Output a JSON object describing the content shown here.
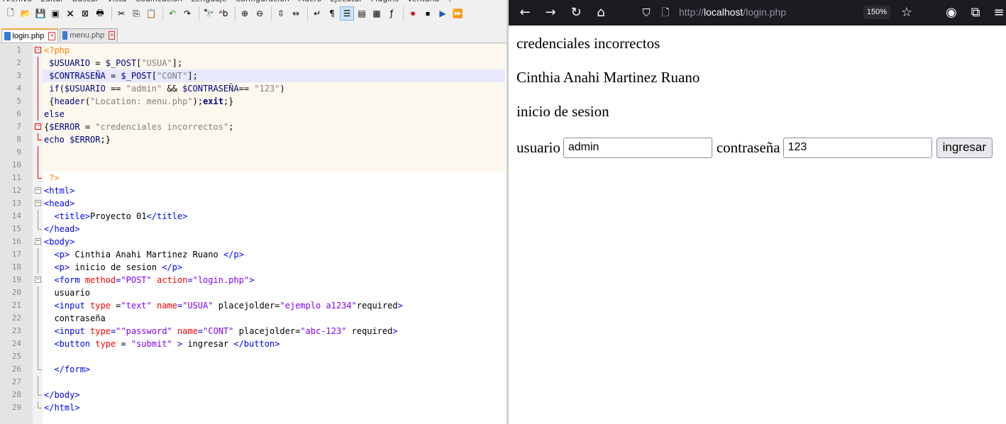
{
  "editor": {
    "menu": [
      "Archivo",
      "Editar",
      "Buscar",
      "Vista",
      "Codificación",
      "Lenguaje",
      "Configuración",
      "Macro",
      "Ejecutar",
      "Plugins",
      "Ventana",
      "?"
    ],
    "tabs": [
      {
        "label": "login.php",
        "active": true
      },
      {
        "label": "menu.php",
        "active": false
      }
    ],
    "lines": [
      {
        "n": "1",
        "seg": [
          [
            "php",
            "<?php"
          ]
        ]
      },
      {
        "n": "2",
        "seg": [
          [
            "var",
            "$USUARIO"
          ],
          [
            "",
            " = "
          ],
          [
            "var",
            "$_POST"
          ],
          [
            "",
            "["
          ],
          [
            "pstr",
            "\"USUA\""
          ],
          [
            "",
            "];"
          ]
        ]
      },
      {
        "n": "3",
        "seg": [
          [
            "var",
            "$CONTRASEÑA"
          ],
          [
            "",
            " = "
          ],
          [
            "var",
            "$_POST"
          ],
          [
            "",
            "["
          ],
          [
            "pstr",
            "\"CONT\""
          ],
          [
            "",
            "];"
          ]
        ]
      },
      {
        "n": "4",
        "seg": [
          [
            "fn",
            "if"
          ],
          [
            "",
            "("
          ],
          [
            "var",
            "$USUARIO"
          ],
          [
            "",
            " == "
          ],
          [
            "pstr",
            "\"admin\""
          ],
          [
            "",
            " && "
          ],
          [
            "var",
            "$CONTRASEÑA"
          ],
          [
            "",
            "== "
          ],
          [
            "pstr",
            "\"123\""
          ],
          [
            "",
            ")"
          ]
        ]
      },
      {
        "n": "5",
        "seg": [
          [
            "",
            "{"
          ],
          [
            "fn",
            "header"
          ],
          [
            "",
            "("
          ],
          [
            "pstr",
            "\"Location: menu.php\""
          ],
          [
            "",
            ");"
          ],
          [
            "kw",
            "exit"
          ],
          [
            "",
            ";}"
          ]
        ]
      },
      {
        "n": "6",
        "seg": [
          [
            "fn",
            "else"
          ]
        ]
      },
      {
        "n": "7",
        "seg": [
          [
            "",
            "{"
          ],
          [
            "var",
            "$ERROR"
          ],
          [
            "",
            " = "
          ],
          [
            "pstr",
            "\"credenciales incorrectos\""
          ],
          [
            "",
            ";"
          ]
        ]
      },
      {
        "n": "8",
        "seg": [
          [
            "fn",
            "echo"
          ],
          [
            "",
            " "
          ],
          [
            "var",
            "$ERROR"
          ],
          [
            "",
            ";}"
          ]
        ]
      },
      {
        "n": "9",
        "seg": []
      },
      {
        "n": "10",
        "seg": []
      },
      {
        "n": "11",
        "seg": [
          [
            "php",
            "?>"
          ]
        ]
      },
      {
        "n": "12",
        "seg": [
          [
            "tag",
            "<html>"
          ]
        ]
      },
      {
        "n": "13",
        "seg": [
          [
            "tag",
            "<head>"
          ]
        ]
      },
      {
        "n": "14",
        "seg": [
          [
            "tag",
            "<title>"
          ],
          [
            "",
            "Proyecto 01"
          ],
          [
            "tag",
            "</title>"
          ]
        ]
      },
      {
        "n": "15",
        "seg": [
          [
            "tag",
            "</head>"
          ]
        ]
      },
      {
        "n": "16",
        "seg": [
          [
            "tag",
            "<body>"
          ]
        ]
      },
      {
        "n": "17",
        "seg": [
          [
            "tag",
            "<p>"
          ],
          [
            "",
            " Cinthia Anahi Martinez Ruano "
          ],
          [
            "tag",
            "</p>"
          ]
        ]
      },
      {
        "n": "18",
        "seg": [
          [
            "tag",
            "<p>"
          ],
          [
            "",
            " inicio de sesion "
          ],
          [
            "tag",
            "</p>"
          ]
        ]
      },
      {
        "n": "19",
        "seg": [
          [
            "tag",
            "<form "
          ],
          [
            "attr",
            "method"
          ],
          [
            "tag",
            "="
          ],
          [
            "str",
            "\"POST\""
          ],
          [
            "",
            " "
          ],
          [
            "attr",
            "action"
          ],
          [
            "tag",
            "="
          ],
          [
            "str",
            "\"login.php\""
          ],
          [
            "tag",
            ">"
          ]
        ]
      },
      {
        "n": "20",
        "seg": [
          [
            "",
            "usuario"
          ]
        ]
      },
      {
        "n": "21",
        "seg": [
          [
            "tag",
            "<input "
          ],
          [
            "attr",
            "type"
          ],
          [
            "",
            " ="
          ],
          [
            "str",
            "\"text\""
          ],
          [
            "",
            " "
          ],
          [
            "attr",
            "name"
          ],
          [
            "tag",
            "="
          ],
          [
            "str",
            "\"USUA\""
          ],
          [
            "",
            " placejolder="
          ],
          [
            "str",
            "\"ejemplo a1234\""
          ],
          [
            "",
            "required"
          ],
          [
            "tag",
            ">"
          ]
        ]
      },
      {
        "n": "22",
        "seg": [
          [
            "",
            "contraseña"
          ]
        ]
      },
      {
        "n": "23",
        "seg": [
          [
            "tag",
            "<input "
          ],
          [
            "attr",
            "type"
          ],
          [
            "tag",
            "="
          ],
          [
            "str",
            "\"\"password\""
          ],
          [
            "",
            " "
          ],
          [
            "attr",
            "name"
          ],
          [
            "tag",
            "="
          ],
          [
            "str",
            "\"CONT\""
          ],
          [
            "",
            " placejolder="
          ],
          [
            "str",
            "\"abc-123\""
          ],
          [
            "",
            " required"
          ],
          [
            "tag",
            ">"
          ]
        ]
      },
      {
        "n": "24",
        "seg": [
          [
            "tag",
            "<button "
          ],
          [
            "attr",
            "type"
          ],
          [
            "",
            " = "
          ],
          [
            "str",
            "\"submit\""
          ],
          [
            "",
            " "
          ],
          [
            "tag",
            ">"
          ],
          [
            "",
            " ingresar "
          ],
          [
            "tag",
            "</button>"
          ]
        ]
      },
      {
        "n": "25",
        "seg": []
      },
      {
        "n": "26",
        "seg": [
          [
            "tag",
            "</form>"
          ]
        ]
      },
      {
        "n": "27",
        "seg": []
      },
      {
        "n": "28",
        "seg": [
          [
            "tag",
            "</body>"
          ]
        ]
      },
      {
        "n": "29",
        "seg": [
          [
            "tag",
            "</html>"
          ]
        ]
      }
    ]
  },
  "browser": {
    "url_scheme": "http://",
    "url_host": "localhost",
    "url_path": "/login.php",
    "zoom": "150%",
    "page": {
      "error": "credenciales incorrectos",
      "name": "Cinthia Anahi Martinez Ruano",
      "heading": "inicio de sesion",
      "user_label": "usuario",
      "user_value": "admin",
      "pass_label": "contraseña",
      "pass_value": "123",
      "submit_label": "ingresar"
    }
  },
  "colors": {
    "browser_toolbar": "#1c1b22",
    "active_tab_accent": "#f3a33e",
    "current_line": "#e8e8ff"
  }
}
